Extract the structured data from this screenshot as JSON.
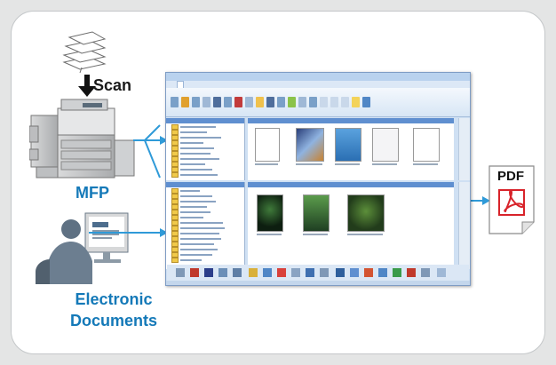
{
  "labels": {
    "scan": "Scan",
    "mfp": "MFP",
    "electronic_line1": "Electronic",
    "electronic_line2": "Documents",
    "output": "PDF"
  },
  "colors": {
    "accent": "#1479b8",
    "arrow": "#2f9ad8",
    "pdf_red": "#d8232a",
    "background": "#e4e5e5"
  },
  "icons": [
    "paper-stack-icon",
    "mfp-printer-icon",
    "person-at-computer-icon",
    "pdf-document-icon"
  ],
  "flows": [
    {
      "from": "MFP",
      "to": "document-software-window"
    },
    {
      "from": "Electronic Documents",
      "to": "document-software-window"
    },
    {
      "from": "document-software-window",
      "to": "PDF"
    }
  ]
}
